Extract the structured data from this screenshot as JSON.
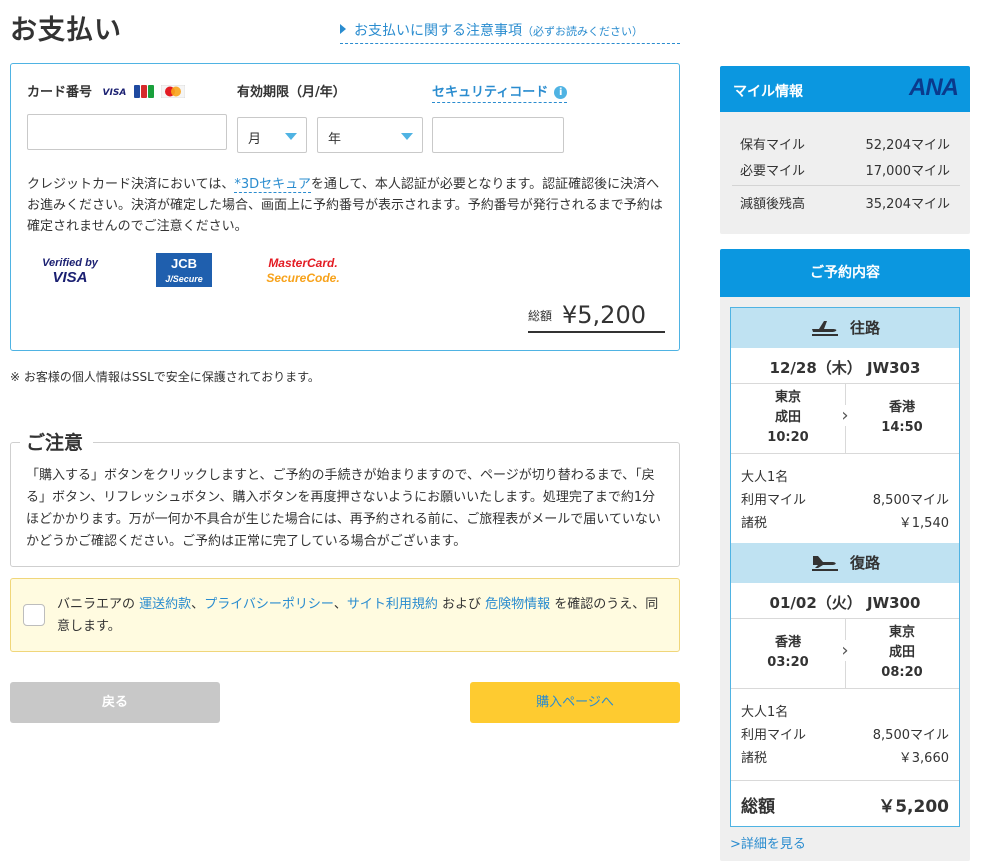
{
  "header": {
    "title": "お支払い",
    "notice_link": "お支払いに関する注意事項",
    "notice_sub": "（必ずお読みください）"
  },
  "card_form": {
    "card_number_label": "カード番号",
    "brand_mini": [
      "VISA",
      "JCB",
      "MasterCard"
    ],
    "expiry_label": "有効期限（月/年）",
    "security_code_label": "セキュリティコード",
    "card_number_value": "",
    "month_placeholder": "月",
    "year_placeholder": "年",
    "security_code_value": "",
    "desc_part1": "クレジットカード決済においては、",
    "desc_link": "*3Dセキュア",
    "desc_part2": "を通して、本人認証が必要となります。認証確認後に決済へお進みください。決済が確定した場合、画面上に予約番号が表示されます。予約番号が発行されるまで予約は確定されませんのでご注意ください。",
    "logos": {
      "visa_line1": "Verified by",
      "visa_line2": "VISA",
      "jcb_line1": "JCB",
      "jcb_line2": "J/Secure",
      "mc_line1": "MasterCard.",
      "mc_line2": "SecureCode."
    },
    "total_label": "総額",
    "total_value": "¥5,200"
  },
  "ssl_note": "※ お客様の個人情報はSSLで安全に保護されております。",
  "caution": {
    "title": "ご注意",
    "text": "「購入する」ボタンをクリックしますと、ご予約の手続きが始まりますので、ページが切り替わるまで、「戻る」ボタン、リフレッシュボタン、購入ボタンを再度押さないようにお願いいたします。処理完了まで約1分ほどかかります。万が一何か不具合が生じた場合には、再予約される前に、ご旅程表がメールで届いていないかどうかご確認ください。ご予約は正常に完了している場合がございます。"
  },
  "agreement": {
    "prefix": "バニラエアの",
    "link1": "運送約款",
    "sep1": "、",
    "link2": "プライバシーポリシー",
    "sep2": "、",
    "link3": "サイト利用規約",
    "mid": "および",
    "link4": "危険物情報",
    "suffix": "を確認のうえ、同意します。"
  },
  "buttons": {
    "back": "戻る",
    "purchase": "購入ページへ"
  },
  "mile_info": {
    "title": "マイル情報",
    "brand": "ANA",
    "rows": [
      {
        "label": "保有マイル",
        "value": "52,204マイル"
      },
      {
        "label": "必要マイル",
        "value": "17,000マイル"
      },
      {
        "label": "減額後残高",
        "value": "35,204マイル"
      }
    ]
  },
  "reservation": {
    "title": "ご予約内容",
    "outbound": {
      "direction": "往路",
      "date_flight": "12/28（木） JW303",
      "from_city": "東京",
      "from_airport": "成田",
      "from_time": "10:20",
      "to_city": "香港",
      "to_time": "14:50",
      "pax": "大人1名",
      "miles_label": "利用マイル",
      "miles_value": "8,500マイル",
      "tax_label": "諸税",
      "tax_value": "￥1,540"
    },
    "inbound": {
      "direction": "復路",
      "date_flight": "01/02（火） JW300",
      "from_city": "香港",
      "from_time": "03:20",
      "to_city": "東京",
      "to_airport": "成田",
      "to_time": "08:20",
      "pax": "大人1名",
      "miles_label": "利用マイル",
      "miles_value": "8,500マイル",
      "tax_label": "諸税",
      "tax_value": "￥3,660"
    },
    "total_label": "総額",
    "total_value": "￥5,200",
    "detail_link": ">詳細を見る"
  },
  "colors": {
    "accent_blue": "#0b97e0",
    "link_blue": "#2a8ccf",
    "light_blue": "#bfe2f2",
    "purchase_yellow": "#fecb30",
    "back_gray": "#c8c8c8"
  }
}
